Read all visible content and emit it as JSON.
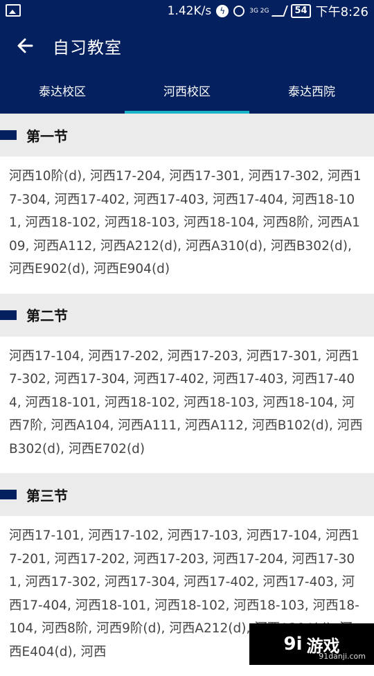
{
  "status": {
    "speed": "1.42K/s",
    "net": "3G 2G",
    "battery": "54",
    "time": "下午8:26"
  },
  "appbar": {
    "title": "自习教室"
  },
  "tabs": [
    "泰达校区",
    "河西校区",
    "泰达西院"
  ],
  "sections": [
    {
      "title": "第一节",
      "rooms": "河西10阶(d), 河西17-204, 河西17-301, 河西17-302, 河西17-304, 河西17-402, 河西17-403, 河西17-404, 河西18-101, 河西18-102, 河西18-103, 河西18-104, 河西8阶, 河西A109, 河西A112, 河西A212(d), 河西A310(d), 河西B302(d), 河西E902(d), 河西E904(d)"
    },
    {
      "title": "第二节",
      "rooms": "河西17-104, 河西17-202, 河西17-203, 河西17-301, 河西17-302, 河西17-304, 河西17-402, 河西17-403, 河西17-404, 河西18-101, 河西18-102, 河西18-103, 河西18-104, 河西7阶, 河西A104, 河西A111, 河西A112, 河西B102(d), 河西B302(d), 河西E702(d)"
    },
    {
      "title": "第三节",
      "rooms": "河西17-101, 河西17-102, 河西17-103, 河西17-104, 河西17-201, 河西17-202, 河西17-203, 河西17-204, 河西17-301, 河西17-302, 河西17-304, 河西17-402, 河西17-403, 河西17-404, 河西18-101, 河西18-102, 河西18-103, 河西18-104, 河西8阶, 河西9阶(d), 河西A212(d), 河西A304(d), 河西E404(d), 河西"
    }
  ],
  "watermark": {
    "logo": "9i",
    "name": "游戏",
    "url": "91danji.com"
  }
}
